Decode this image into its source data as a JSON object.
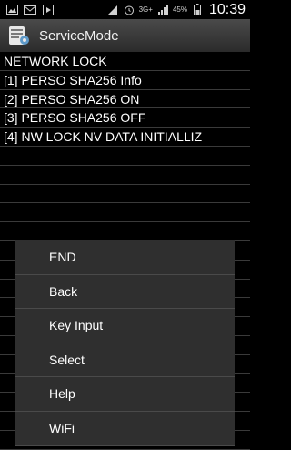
{
  "status_bar": {
    "left_icons": [
      "gallery-icon",
      "mail-icon",
      "play-icon"
    ],
    "right_icons": [
      "signal-icon",
      "alarm-icon",
      "network-3g-icon",
      "signal-bars-icon",
      "battery-icon"
    ],
    "network_type": "3G+",
    "battery": "45%",
    "time": "10:39"
  },
  "app": {
    "title": "ServiceMode",
    "icon": "service-mode-app-icon"
  },
  "console": {
    "lines": [
      "NETWORK LOCK",
      "[1] PERSO SHA256 Info",
      "[2] PERSO SHA256 ON",
      "[3] PERSO SHA256 OFF",
      "[4] NW LOCK NV DATA INITIALLIZ",
      "",
      "",
      "",
      "",
      "",
      "",
      "",
      "",
      "",
      "",
      "",
      "",
      "",
      "",
      "",
      ""
    ]
  },
  "menu": {
    "items": [
      "END",
      "Back",
      "Key Input",
      "Select",
      "Help",
      "WiFi"
    ]
  }
}
